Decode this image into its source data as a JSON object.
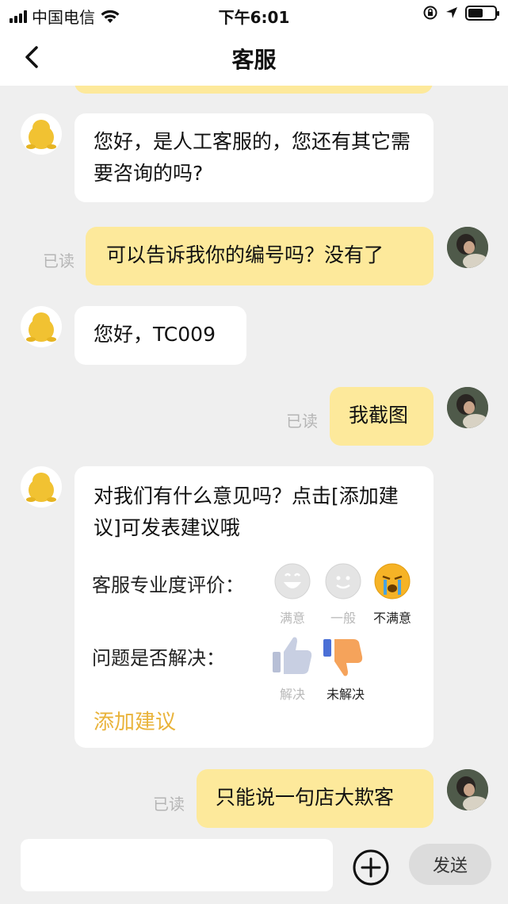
{
  "status_bar": {
    "carrier": "中国电信",
    "time": "下午6:01"
  },
  "nav": {
    "title": "客服"
  },
  "messages": [
    {
      "from": "agent",
      "text": "您好，是人工客服的，您还有其它需要咨询的吗?"
    },
    {
      "from": "me",
      "text": "可以告诉我你的编号吗？没有了",
      "read": "已读"
    },
    {
      "from": "agent",
      "text": "您好，TC009"
    },
    {
      "from": "me",
      "text": "我截图",
      "read": "已读"
    },
    {
      "from": "agent",
      "text": "对我们有什么意见吗？点击[添加建议]可发表建议哦"
    },
    {
      "from": "me",
      "text": "只能说一句店大欺客",
      "read": "已读"
    }
  ],
  "survey": {
    "professional_label": "客服专业度评价：",
    "options": [
      "满意",
      "一般",
      "不满意"
    ],
    "resolved_label": "问题是否解决：",
    "resolve_options": [
      "解决",
      "未解决"
    ],
    "add_suggestion": "添加建议"
  },
  "input": {
    "placeholder": "",
    "send_label": "发送"
  },
  "colors": {
    "user_bubble": "#fde99b",
    "agent_bubble": "#ffffff",
    "accent": "#e9b33a",
    "background": "#efefef"
  }
}
